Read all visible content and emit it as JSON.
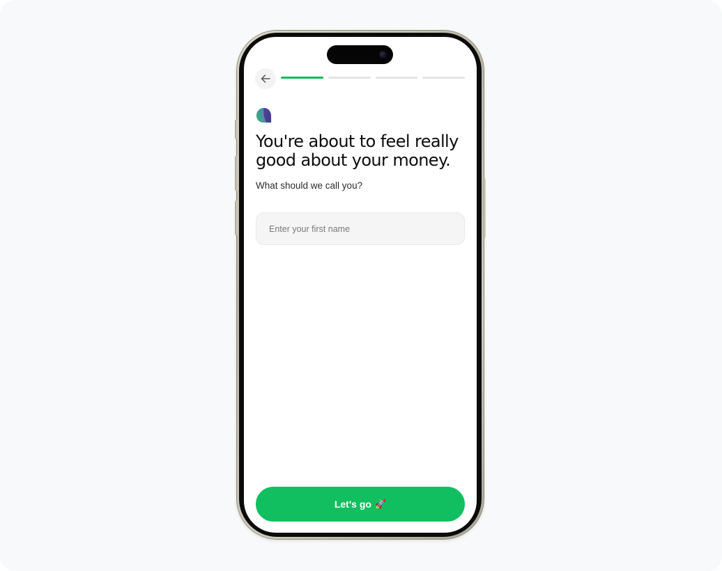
{
  "onboarding": {
    "back_icon": "arrow-left-icon",
    "progress": {
      "total_steps": 4,
      "current_step": 1
    },
    "logo_icon": "brand-logo-icon",
    "headline": "You're about to feel really good about your money.",
    "subtitle": "What should we call you?",
    "name_input": {
      "placeholder": "Enter your first name",
      "value": ""
    },
    "cta": {
      "label": "Let's go",
      "icon": "rocket-icon",
      "icon_glyph": "🚀"
    }
  },
  "colors": {
    "accent": "#12bf60",
    "progress_active": "#12b95e",
    "progress_inactive": "#e4e4e4",
    "logo_teal": "#2f9e8c",
    "logo_purple": "#4b3f8f"
  }
}
